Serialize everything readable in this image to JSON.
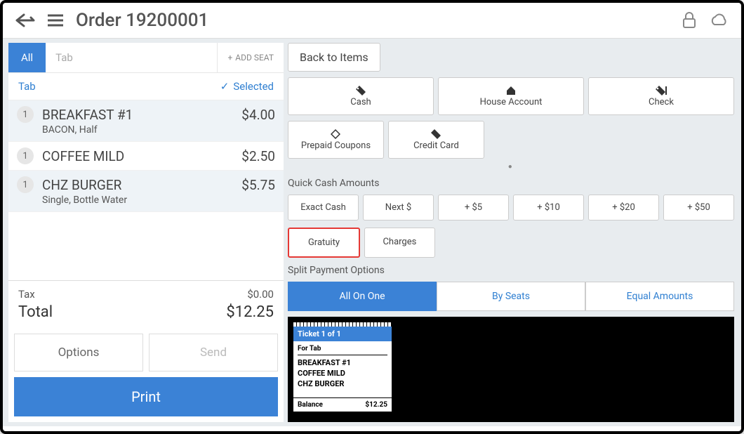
{
  "header": {
    "title": "Order 19200001"
  },
  "left": {
    "tabs": {
      "all": "All",
      "tab": "Tab",
      "addseat": "ADD SEAT"
    },
    "tabhead": {
      "label": "Tab",
      "selected": "Selected"
    },
    "items": [
      {
        "qty": "1",
        "name": "BREAKFAST #1",
        "price": "$4.00",
        "sub": "BACON, Half",
        "selected": true
      },
      {
        "qty": "1",
        "name": "COFFEE MILD",
        "price": "$2.50",
        "sub": "",
        "selected": false
      },
      {
        "qty": "1",
        "name": "CHZ BURGER",
        "price": "$5.75",
        "sub": "Single, Bottle Water",
        "selected": true
      }
    ],
    "tax_label": "Tax",
    "tax_value": "$0.00",
    "total_label": "Total",
    "total_value": "$12.25",
    "options": "Options",
    "send": "Send",
    "print": "Print"
  },
  "right": {
    "back": "Back to Items",
    "pay": [
      "Cash",
      "House Account",
      "Check",
      "Prepaid Coupons",
      "Credit Card"
    ],
    "qc_label": "Quick Cash Amounts",
    "qc": [
      "Exact Cash",
      "Next $",
      "+ $5",
      "+ $10",
      "+ $20",
      "+ $50"
    ],
    "gratuity": "Gratuity",
    "charges": "Charges",
    "split_label": "Split Payment Options",
    "split": [
      "All On One",
      "By Seats",
      "Equal Amounts"
    ],
    "ticket": {
      "head": "Ticket 1 of 1",
      "for": "For Tab",
      "items": [
        "BREAKFAST #1",
        "COFFEE MILD",
        "CHZ BURGER"
      ],
      "bal_label": "Balance",
      "bal_value": "$12.25"
    }
  }
}
